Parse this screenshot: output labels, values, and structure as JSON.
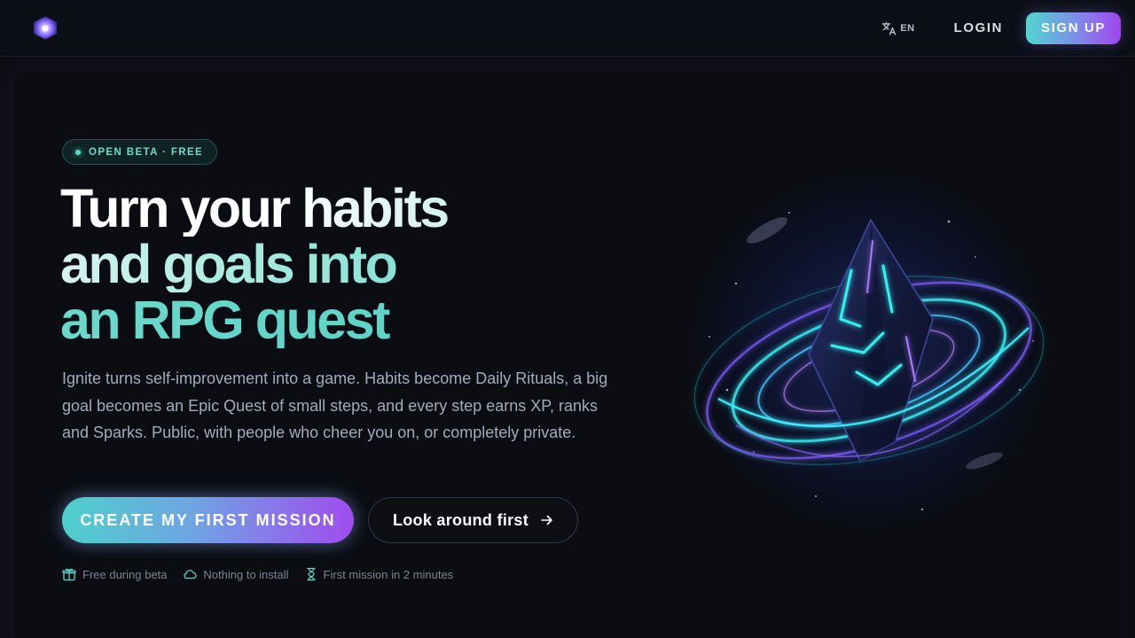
{
  "nav": {
    "language": "EN",
    "login_label": "LOGIN",
    "signup_label": "SIGN UP"
  },
  "hero": {
    "badge": "OPEN BETA · FREE",
    "headline": [
      "Turn your habits",
      "and goals into",
      "an RPG quest"
    ],
    "description": "Ignite turns self-improvement into a game. Habits become Daily Rituals, a big goal becomes an Epic Quest of small steps, and every step earns XP, ranks and Sparks. Public, with people who cheer you on, or completely private.",
    "primary_cta": "CREATE MY FIRST MISSION",
    "secondary_cta": "Look around first",
    "perks": [
      {
        "icon": "gift-icon",
        "label": "Free during beta"
      },
      {
        "icon": "cloud-icon",
        "label": "Nothing to install"
      },
      {
        "icon": "hourglass-icon",
        "label": "First mission in 2 minutes"
      }
    ]
  },
  "icons": {
    "logo": "ignite-crystal-logo",
    "language": "translate-icon",
    "arrow": "arrow-right-icon",
    "hero_art": "crystal-orbit-illustration"
  },
  "colors": {
    "background": "#0b0d12",
    "accent_teal": "#5ed3c8",
    "accent_purple": "#a04ced",
    "text_muted": "#a3abbb"
  }
}
